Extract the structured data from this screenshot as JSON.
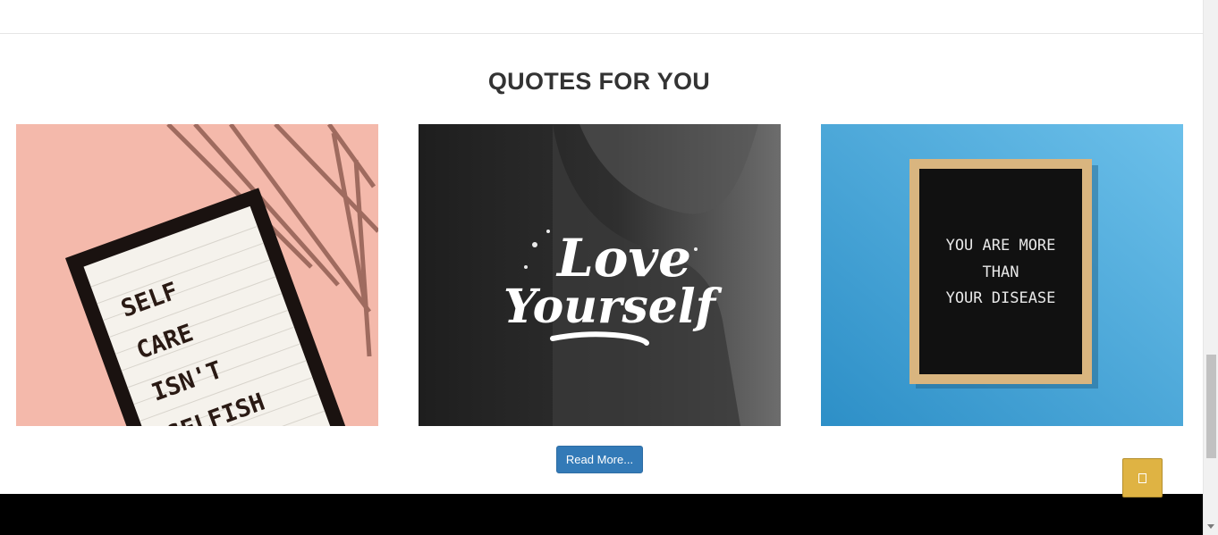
{
  "section": {
    "title": "QUOTES FOR YOU"
  },
  "quotes": [
    {
      "text_lines": [
        "SELF",
        "CARE",
        "ISN'T",
        "SELFISH"
      ]
    },
    {
      "text_lines": [
        "Love",
        "Yourself"
      ]
    },
    {
      "text_lines": [
        "YOU ARE MORE",
        "THAN",
        "YOUR DISEASE"
      ]
    }
  ],
  "actions": {
    "read_more_label": "Read More..."
  },
  "back_to_top": {
    "icon": "arrow-up-icon"
  },
  "colors": {
    "button_primary": "#337ab7",
    "back_to_top": "#dfb343",
    "footer": "#000000",
    "card1_bg": "#f4b9ab",
    "card2_bg": "#2a2a2a",
    "card3_bg": "#4aa9dc"
  }
}
